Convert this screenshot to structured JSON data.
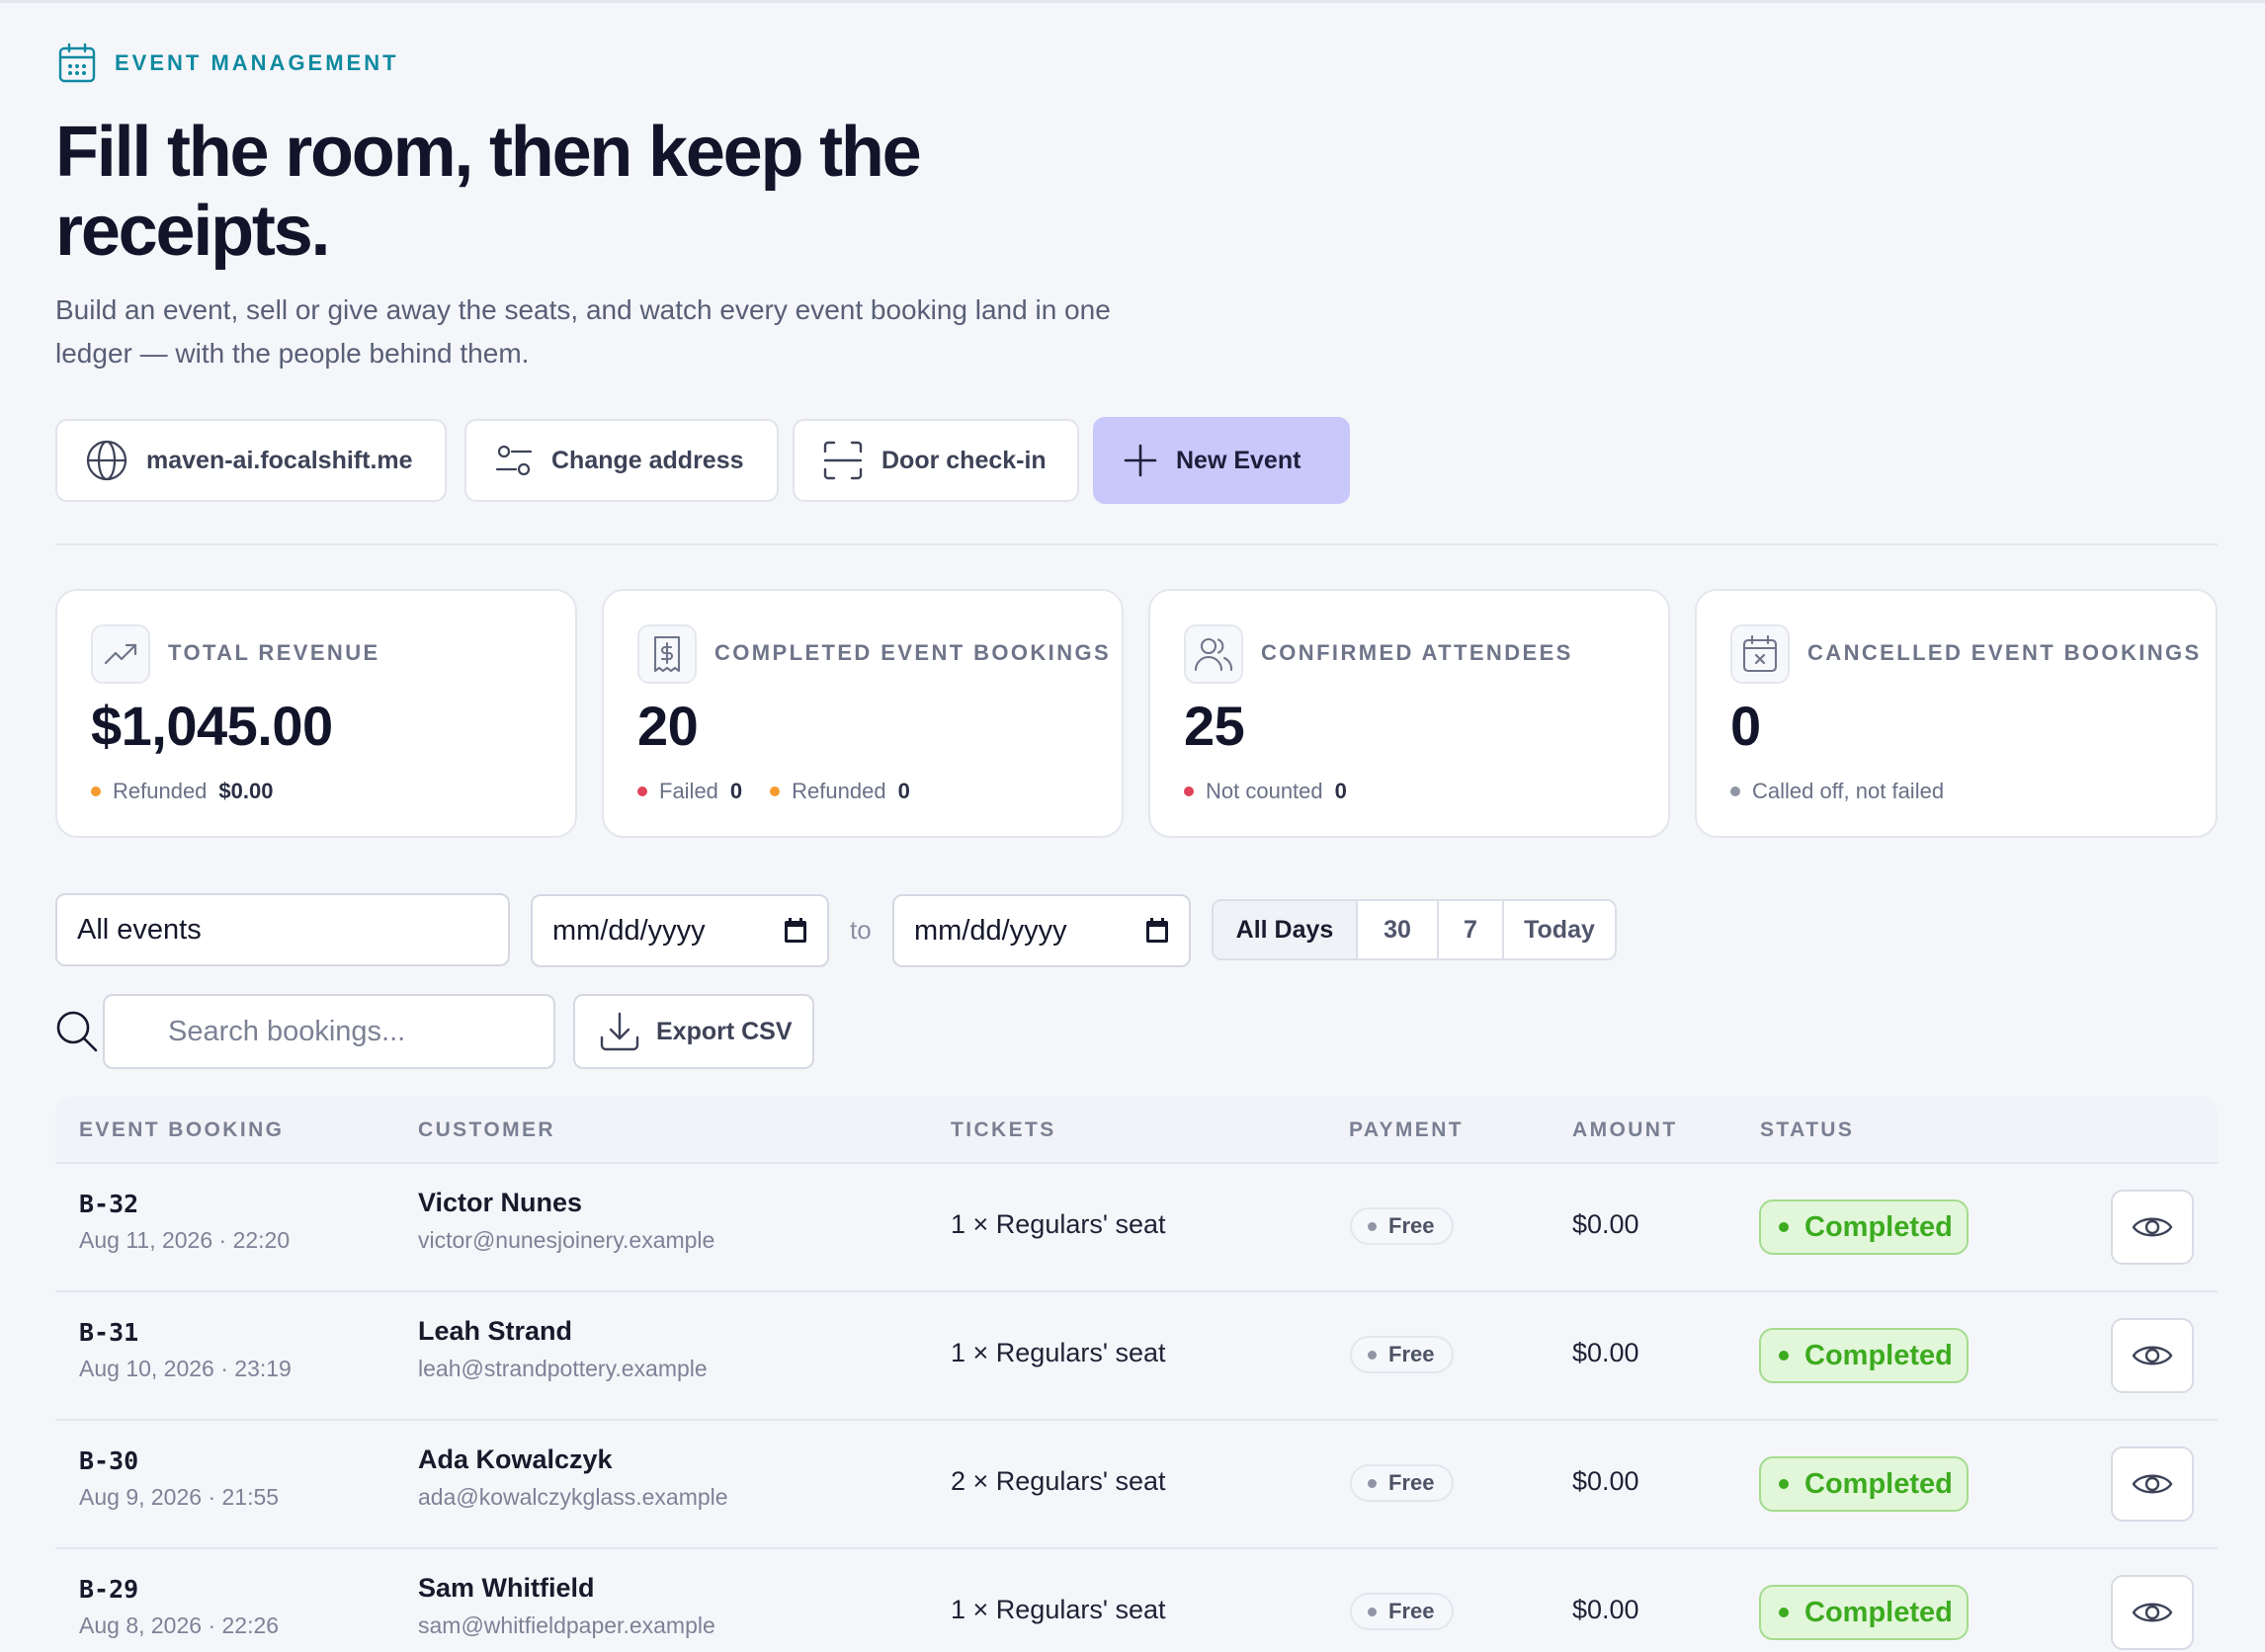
{
  "header": {
    "eyebrow": "EVENT MANAGEMENT",
    "title": "Fill the room, then keep the receipts.",
    "subtitle": "Build an event, sell or give away the seats, and watch every event booking land in one ledger — with the people behind them."
  },
  "actions": {
    "domain_label": "maven-ai.focalshift.me",
    "change_address_label": "Change address",
    "door_checkin_label": "Door check-in",
    "new_event_label": "New Event"
  },
  "stats": {
    "revenue": {
      "label": "TOTAL REVENUE",
      "value": "$1,045.00",
      "refunded_label": "Refunded",
      "refunded_value": "$0.00"
    },
    "completed": {
      "label": "COMPLETED EVENT BOOKINGS",
      "value": "20",
      "failed_label": "Failed",
      "failed_value": "0",
      "refunded_label": "Refunded",
      "refunded_value": "0"
    },
    "attendees": {
      "label": "CONFIRMED ATTENDEES",
      "value": "25",
      "not_counted_label": "Not counted",
      "not_counted_value": "0"
    },
    "cancelled": {
      "label": "CANCELLED EVENT BOOKINGS",
      "value": "0",
      "note": "Called off, not failed"
    }
  },
  "filters": {
    "event_select": "All events",
    "date_from": "mm/dd/yyyy",
    "to_label": "to",
    "date_to": "mm/dd/yyyy",
    "ranges": [
      "All Days",
      "30",
      "7",
      "Today"
    ],
    "active_range": "All Days",
    "search_placeholder": "Search bookings...",
    "export_label": "Export CSV"
  },
  "table": {
    "columns": {
      "booking": "EVENT BOOKING",
      "customer": "CUSTOMER",
      "tickets": "TICKETS",
      "payment": "PAYMENT",
      "amount": "AMOUNT",
      "status": "STATUS"
    },
    "rows": [
      {
        "id": "B-32",
        "date": "Aug 11, 2026 · 22:20",
        "name": "Victor Nunes",
        "email": "victor@nunesjoinery.example",
        "tickets": "1 × Regulars' seat",
        "payment": "Free",
        "amount": "$0.00",
        "status": "Completed"
      },
      {
        "id": "B-31",
        "date": "Aug 10, 2026 · 23:19",
        "name": "Leah Strand",
        "email": "leah@strandpottery.example",
        "tickets": "1 × Regulars' seat",
        "payment": "Free",
        "amount": "$0.00",
        "status": "Completed"
      },
      {
        "id": "B-30",
        "date": "Aug 9, 2026 · 21:55",
        "name": "Ada Kowalczyk",
        "email": "ada@kowalczykglass.example",
        "tickets": "2 × Regulars' seat",
        "payment": "Free",
        "amount": "$0.00",
        "status": "Completed"
      },
      {
        "id": "B-29",
        "date": "Aug 8, 2026 · 22:26",
        "name": "Sam Whitfield",
        "email": "sam@whitfieldpaper.example",
        "tickets": "1 × Regulars' seat",
        "payment": "Free",
        "amount": "$0.00",
        "status": "Completed"
      }
    ]
  },
  "colors": {
    "accent_teal": "#0f8aa0",
    "primary_button": "#c9c8fb",
    "status_completed": "#3cab1f",
    "dot_orange": "#f59a2e",
    "dot_red": "#e0425a"
  },
  "icons": [
    "calendar-icon",
    "globe-icon",
    "sliders-icon",
    "scan-icon",
    "plus-icon",
    "trend-up-icon",
    "receipt-icon",
    "users-icon",
    "calendar-x-icon",
    "calendar-picker-icon",
    "search-icon",
    "download-icon",
    "eye-icon"
  ]
}
